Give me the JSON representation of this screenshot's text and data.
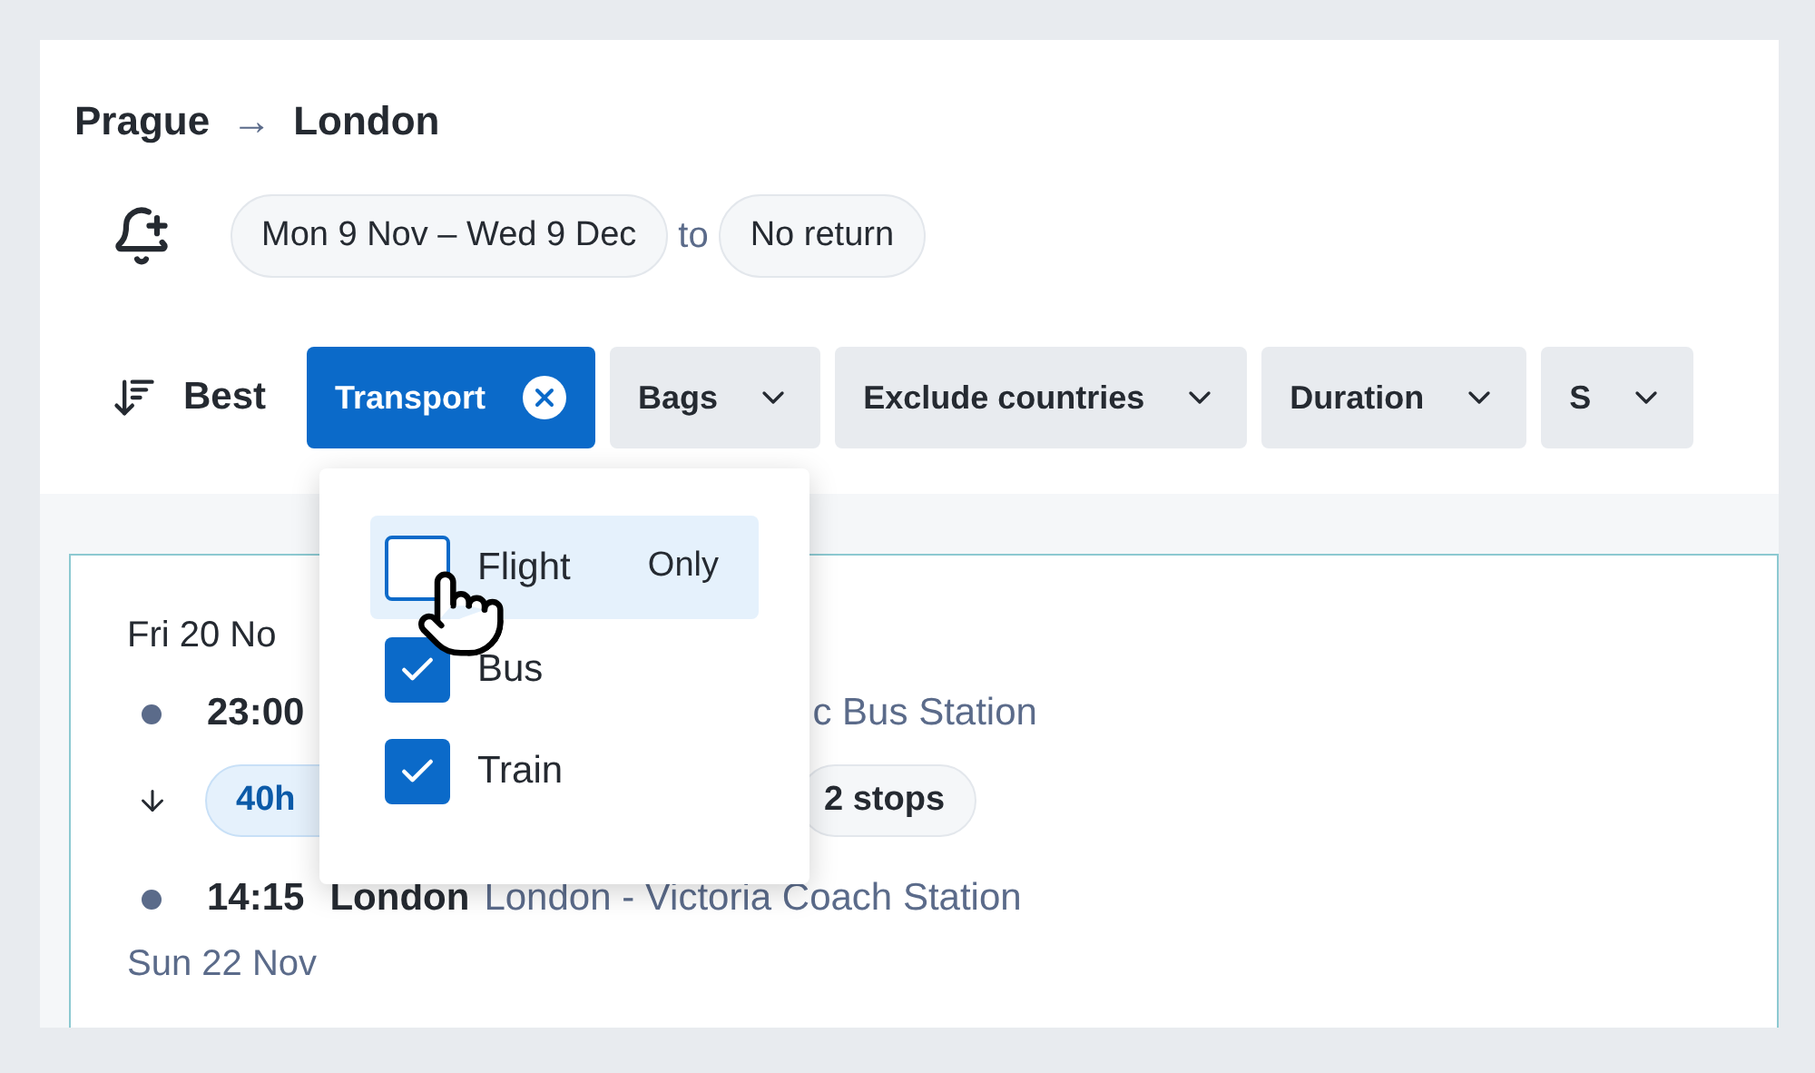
{
  "route": {
    "origin": "Prague",
    "arrow": "→",
    "destination": "London"
  },
  "dates": {
    "departure": "Mon 9 Nov – Wed 9 Dec",
    "joiner": "to",
    "return": "No return"
  },
  "sort": {
    "label": "Best"
  },
  "filters": [
    {
      "label": "Transport",
      "active": true
    },
    {
      "label": "Bags",
      "active": false
    },
    {
      "label": "Exclude countries",
      "active": false
    },
    {
      "label": "Duration",
      "active": false
    },
    {
      "label": "S",
      "active": false
    }
  ],
  "transport_menu": {
    "options": [
      {
        "label": "Flight",
        "checked": false,
        "hovered": true,
        "action": "Only"
      },
      {
        "label": "Bus",
        "checked": true,
        "hovered": false
      },
      {
        "label": "Train",
        "checked": true,
        "hovered": false
      }
    ]
  },
  "result": {
    "date_out": "Fri 20 No",
    "departure": {
      "time": "23:00",
      "station": "c Bus Station"
    },
    "duration": "40h",
    "stops": "2 stops",
    "arrival": {
      "time": "14:15",
      "city": "London",
      "station": "London - Victoria Coach Station"
    },
    "date_in": "Sun 22 Nov"
  }
}
